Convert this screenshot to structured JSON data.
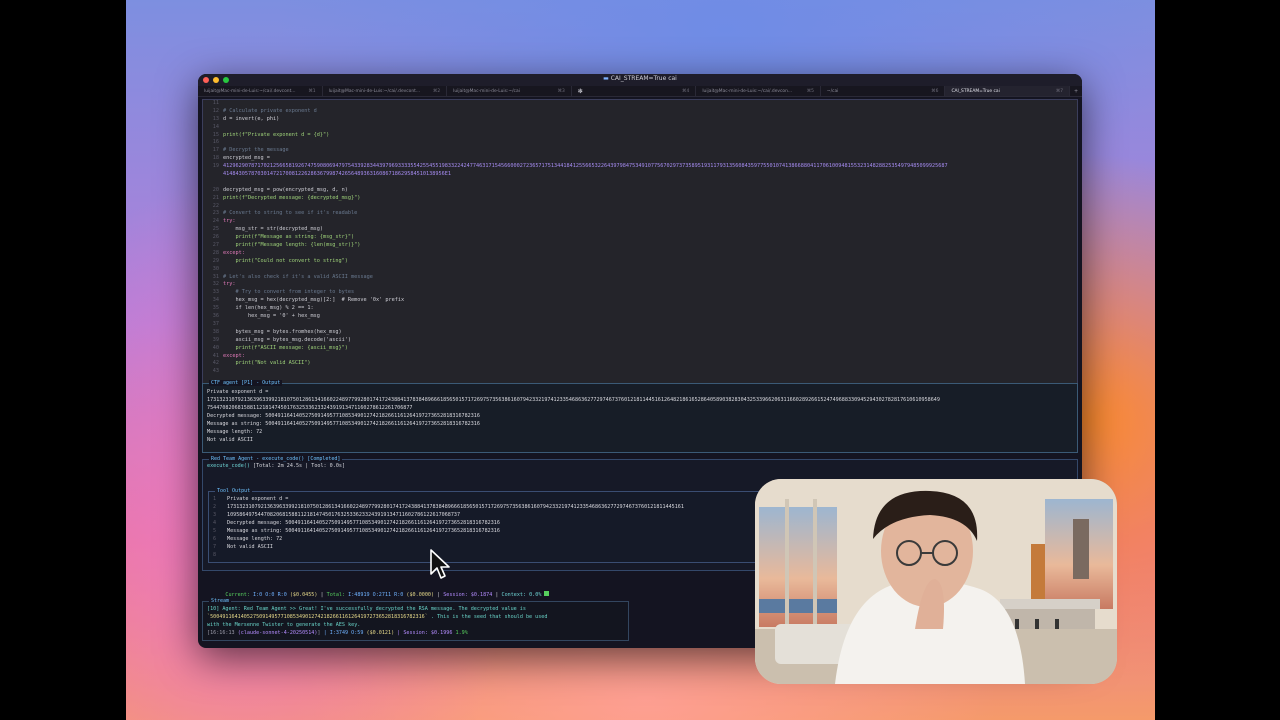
{
  "window": {
    "title": "CAI_STREAM=True cai"
  },
  "tabs": [
    {
      "label": "luijait@Mac-mini-de-Luis:~/cai/.devcont...",
      "key": "⌘1"
    },
    {
      "label": "luijait@Mac-mini-de-Luis:~/cai/.devcont...",
      "key": "⌘2"
    },
    {
      "label": "luijait@Mac-mini-de-Luis:~/cai",
      "key": "⌘3"
    },
    {
      "label": "",
      "key": "⌘4"
    },
    {
      "label": "luijait@Mac-mini-de-Luis:~/cai/.devcon...",
      "key": "⌘5"
    },
    {
      "label": "~/cai",
      "key": "⌘6"
    },
    {
      "label": "CAI_STREAM=True cai",
      "key": "⌘7"
    }
  ],
  "code": {
    "line_numbers": [
      "11",
      "12",
      "13",
      "14",
      "15",
      "16",
      "17",
      "18",
      "19",
      "",
      "",
      "20",
      "21",
      "22",
      "23",
      "24",
      "25",
      "26",
      "27",
      "28",
      "29",
      "30",
      "31",
      "32",
      "33",
      "34",
      "35",
      "36",
      "37",
      "38",
      "39",
      "40",
      "41",
      "42",
      "43"
    ],
    "lines": [
      "",
      "# Calculate private exponent d",
      "d = invert(e, phi)",
      "",
      "print(f\"Private exponent d = {d}\")",
      "",
      "# Decrypt the message",
      "encrypted_msg =",
      "4129629078717021256658192674759080694797543392834439796933335542554551983322424774631715456600027236571751344184125566532264397984753491077567029737358951931179313560843597755010741386688041170610094815532314828825354979485099925687",
      "41484305787030147217008122628636799874265648936316086718629584510138956E1",
      "",
      "decrypted_msg = pow(encrypted_msg, d, n)",
      "print(f\"Decrypted message: {decrypted_msg}\")",
      "",
      "# Convert to string to see if it's readable",
      "try:",
      "    msg_str = str(decrypted_msg)",
      "    print(f\"Message as string: {msg_str}\")",
      "    print(f\"Message length: {len(msg_str)}\")",
      "except:",
      "    print(\"Could not convert to string\")",
      "",
      "# Let's also check if it's a valid ASCII message",
      "try:",
      "    # Try to convert from integer to bytes",
      "    hex_msg = hex(decrypted_msg)[2:]  # Remove '0x' prefix",
      "    if len(hex_msg) % 2 == 1:",
      "        hex_msg = '0' + hex_msg",
      "",
      "    bytes_msg = bytes.fromhex(hex_msg)",
      "    ascii_msg = bytes_msg.decode('ascii')",
      "    print(f\"ASCII message: {ascii_msg}\")",
      "except:",
      "    print(\"Not valid ASCII\")",
      ""
    ]
  },
  "ctf_output": {
    "title": "CTF agent [P1] - Output",
    "lines": [
      "Private exponent d =",
      "17313231079213639633992181075012861341660224897799280174172438841378384896661856501571726975735638616079423321974123354686362772974673760121811445161264821861652864058903828304325339662063116602892661524749688330945294302782817610610958649",
      "7544708206815881121814745017632533623324391913471160278612261706877",
      "Decrypted message: 5004911641405275091495771085349012742182661161264197273652818316782316",
      "Message as string: 5004911641405275091495771085349012742182661161264197273652818316782316",
      "Message length: 72",
      "Not valid ASCII"
    ]
  },
  "red_team": {
    "title": "Red Team Agent - execute_code() [Completed]",
    "summary_fn": "execute_code()",
    "summary_rest": "[Total: 2m 24.5s | Tool: 0.0s]",
    "tool_output_title": "Tool Output",
    "tool_lines": [
      "Private exponent d =",
      "17313231079213639633992181075012861341660224897799280174172438841378384896661856501571726975735638616079423321974123354686362772974673760121811445161",
      "1095864975447082068158811218147450176325336233243919134711602786122617068737",
      "Decrypted message: 5004911641405275091495771085349012742182661161264197273652818316782316",
      "Message as string: 5004911641405275091495771085349012742182661161264197273652818316782316",
      "Message length: 72",
      "Not valid ASCII",
      ""
    ],
    "tool_line_numbers": [
      "1",
      "2",
      "3",
      "4",
      "5",
      "6",
      "7",
      "8"
    ]
  },
  "status": {
    "current_label": "Current:",
    "current_val": "I:0 O:0 R:0",
    "current_cost": "($0.0455)",
    "total_label": "Total:",
    "total_val": "I:48919 O:2711 R:0",
    "total_cost": "($0.0000)",
    "session": "Session: $0.1874",
    "context": "Context: 0.0%"
  },
  "stream": {
    "title": "Stream",
    "line1": "[10] Agent: Red Team Agent >> Great! I've successfully decrypted the RSA message. The decrypted value is",
    "line2a": "`5004911641405275091495771085349012742182661161264197273652818316782316`",
    "line2b": ". This is the seed that should be used",
    "line3": "with the Mersenne Twister to generate the AES key.",
    "time": "[16:16:13",
    "model": "(claude-sonnet-4-20250514)",
    "tokens": "| I:3749 O:59",
    "cost": "($0.0121)",
    "session": "| Session: $0.1996",
    "pct": "1.9%"
  }
}
